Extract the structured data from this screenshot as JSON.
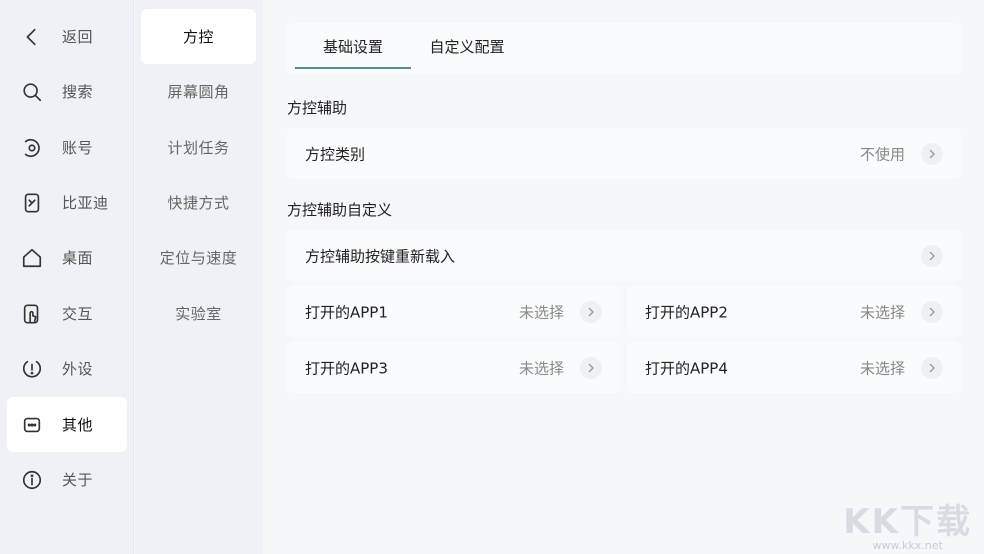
{
  "nav": {
    "items": [
      {
        "label": "返回",
        "icon": "back-icon"
      },
      {
        "label": "搜索",
        "icon": "search-icon"
      },
      {
        "label": "账号",
        "icon": "account-icon"
      },
      {
        "label": "比亚迪",
        "icon": "byd-icon"
      },
      {
        "label": "桌面",
        "icon": "home-icon"
      },
      {
        "label": "交互",
        "icon": "interaction-icon"
      },
      {
        "label": "外设",
        "icon": "peripheral-icon"
      },
      {
        "label": "其他",
        "icon": "more-icon"
      },
      {
        "label": "关于",
        "icon": "info-icon"
      }
    ],
    "active_index": 7
  },
  "subnav": {
    "items": [
      "方控",
      "屏幕圆角",
      "计划任务",
      "快捷方式",
      "定位与速度",
      "实验室"
    ],
    "active_index": 0
  },
  "tabs": {
    "items": [
      "基础设置",
      "自定义配置"
    ],
    "active_index": 0
  },
  "sections": {
    "assist": {
      "title": "方控辅助",
      "type_row": {
        "label": "方控类别",
        "value": "不使用"
      }
    },
    "custom": {
      "title": "方控辅助自定义",
      "reload_row": {
        "label": "方控辅助按键重新载入"
      },
      "apps": [
        {
          "label": "打开的APP1",
          "value": "未选择"
        },
        {
          "label": "打开的APP2",
          "value": "未选择"
        },
        {
          "label": "打开的APP3",
          "value": "未选择"
        },
        {
          "label": "打开的APP4",
          "value": "未选择"
        }
      ]
    }
  },
  "watermark": {
    "logo": "KK下载",
    "url": "www.kkx.net"
  },
  "colors": {
    "accent": "#5b8a86",
    "nav_bg": "#eef1f6",
    "main_bg": "#f5f7fa",
    "card_bg": "#fafbfd"
  }
}
